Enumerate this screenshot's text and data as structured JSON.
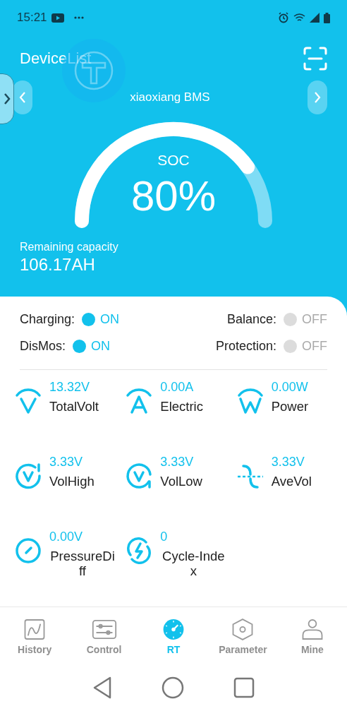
{
  "status_bar": {
    "time": "15:21"
  },
  "header": {
    "title": "DeviceList",
    "device_name": "xiaoxiang BMS"
  },
  "gauge": {
    "label": "SOC",
    "value": "80%"
  },
  "capacity": {
    "label": "Remaining capacity",
    "value": "106.17AH"
  },
  "switches": [
    {
      "label": "Charging:",
      "state": "ON",
      "on": true
    },
    {
      "label": "Balance:",
      "state": "OFF",
      "on": false
    },
    {
      "label": "DisMos:",
      "state": "ON",
      "on": true
    },
    {
      "label": "Protection:",
      "state": "OFF",
      "on": false
    }
  ],
  "metrics": [
    {
      "kind": "volt",
      "value": "13.32V",
      "label": "TotalVolt"
    },
    {
      "kind": "amp",
      "value": "0.00A",
      "label": "Electric"
    },
    {
      "kind": "watt",
      "value": "0.00W",
      "label": "Power"
    },
    {
      "kind": "high",
      "value": "3.33V",
      "label": "VolHigh"
    },
    {
      "kind": "low",
      "value": "3.33V",
      "label": "VolLow"
    },
    {
      "kind": "ave",
      "value": "3.33V",
      "label": "AveVol"
    },
    {
      "kind": "diff",
      "value": "0.00V",
      "label": "PressureDiff"
    },
    {
      "kind": "cycle",
      "value": "0",
      "label": "Cycle-Index"
    }
  ],
  "tabs": [
    {
      "kind": "history",
      "label": "History",
      "selected": false
    },
    {
      "kind": "control",
      "label": "Control",
      "selected": false
    },
    {
      "kind": "rt",
      "label": "RT",
      "selected": true
    },
    {
      "kind": "parameter",
      "label": "Parameter",
      "selected": false
    },
    {
      "kind": "mine",
      "label": "Mine",
      "selected": false
    }
  ]
}
